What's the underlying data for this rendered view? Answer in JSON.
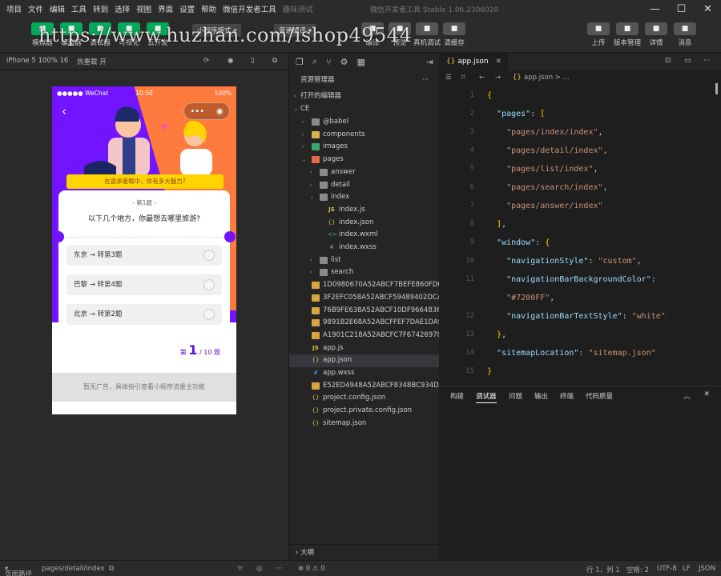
{
  "menubar": {
    "items": [
      "项目",
      "文件",
      "编辑",
      "工具",
      "转到",
      "选择",
      "视图",
      "界面",
      "设置",
      "帮助",
      "微信开发者工具"
    ],
    "extra": "趣味测试",
    "title": "微信开发者工具 Stable 1.06.2306020"
  },
  "toolbar": {
    "left": [
      {
        "icon": "simulator-icon",
        "label": "模拟器"
      },
      {
        "icon": "editor-icon",
        "label": "编辑器"
      },
      {
        "icon": "debugger-icon",
        "label": "调试器"
      },
      {
        "icon": "visualize-icon",
        "label": "可视化"
      },
      {
        "icon": "cloud-icon",
        "label": "云开发"
      }
    ],
    "mode_select": "小程序模式",
    "compile_select": "普通编译",
    "right_mid": [
      {
        "icon": "compile-icon",
        "label": "编译"
      },
      {
        "icon": "preview-icon",
        "label": "预览"
      },
      {
        "icon": "remote-debug-icon",
        "label": "真机调试"
      },
      {
        "icon": "clear-cache-icon",
        "label": "清缓存"
      }
    ],
    "right": [
      {
        "icon": "upload-icon",
        "label": "上传"
      },
      {
        "icon": "version-icon",
        "label": "版本管理"
      },
      {
        "icon": "details-icon",
        "label": "详情"
      },
      {
        "icon": "message-icon",
        "label": "消息"
      }
    ]
  },
  "watermark": "https://www.huzhan.com/ishop49544",
  "simulator": {
    "device": "iPhone 5 100% 16",
    "hot_reload": "热重载 开",
    "status": {
      "carrier": "●●●●● WeChat",
      "time": "10:50",
      "battery": "100%"
    },
    "banner": "在逃求者眼中，你有多大魅力?",
    "question_index": "- 第1题 -",
    "question": "以下几个地方，你最想去哪里旅游?",
    "options": [
      "东京 → 转第3题",
      "巴黎 → 转第4题",
      "北京 → 转第2题"
    ],
    "progress_prefix": "第",
    "progress_current": "1",
    "progress_suffix": "/ 10 题",
    "ad_text": "暂无广告，具体指引查看小程序流量主功能"
  },
  "explorer": {
    "header": "资源管理器",
    "open_editors": "打开的编辑器",
    "root": "CE",
    "outline": "大纲",
    "tree": [
      {
        "name": "@babel",
        "type": "folder",
        "depth": 1
      },
      {
        "name": "components",
        "type": "folder",
        "depth": 1
      },
      {
        "name": "images",
        "type": "folder",
        "depth": 1
      },
      {
        "name": "pages",
        "type": "folder",
        "depth": 1,
        "open": true
      },
      {
        "name": "answer",
        "type": "folder",
        "depth": 2
      },
      {
        "name": "detail",
        "type": "folder",
        "depth": 2
      },
      {
        "name": "index",
        "type": "folder",
        "depth": 2,
        "open": true
      },
      {
        "name": "index.js",
        "type": "js",
        "depth": 3
      },
      {
        "name": "index.json",
        "type": "json",
        "depth": 3
      },
      {
        "name": "index.wxml",
        "type": "wxml",
        "depth": 3
      },
      {
        "name": "index.wxss",
        "type": "wxss",
        "depth": 3
      },
      {
        "name": "list",
        "type": "folder",
        "depth": 2
      },
      {
        "name": "search",
        "type": "folder",
        "depth": 2
      },
      {
        "name": "1D0980670A52ABCF7BEFE860FD6...",
        "type": "png",
        "depth": 1
      },
      {
        "name": "3F2EFC058A52ABCF59489402DCA...",
        "type": "png",
        "depth": 1
      },
      {
        "name": "76B9FE638A52ABCF10DF9664836...",
        "type": "png",
        "depth": 1
      },
      {
        "name": "9891B2E68A52ABCFFEF7DAE1DA9...",
        "type": "png",
        "depth": 1
      },
      {
        "name": "A1901C218A52ABCFC7F67426978...",
        "type": "png",
        "depth": 1
      },
      {
        "name": "app.js",
        "type": "js",
        "depth": 1
      },
      {
        "name": "app.json",
        "type": "json",
        "depth": 1,
        "selected": true
      },
      {
        "name": "app.wxss",
        "type": "wxss",
        "depth": 1
      },
      {
        "name": "E52ED4948A52ABCF8348BC934D...",
        "type": "png",
        "depth": 1
      },
      {
        "name": "project.config.json",
        "type": "json",
        "depth": 1
      },
      {
        "name": "project.private.config.json",
        "type": "json",
        "depth": 1
      },
      {
        "name": "sitemap.json",
        "type": "json",
        "depth": 1
      }
    ]
  },
  "editor": {
    "tab": "app.json",
    "breadcrumb": "app.json > ...",
    "lines": [
      {
        "n": "1",
        "t": "{"
      },
      {
        "n": "2",
        "t": "  \"pages\": ["
      },
      {
        "n": "3",
        "t": "    \"pages/index/index\","
      },
      {
        "n": "4",
        "t": "    \"pages/detail/index\","
      },
      {
        "n": "5",
        "t": "    \"pages/list/index\","
      },
      {
        "n": "6",
        "t": "    \"pages/search/index\","
      },
      {
        "n": "7",
        "t": "    \"pages/answer/index\""
      },
      {
        "n": "8",
        "t": "  ],"
      },
      {
        "n": "9",
        "t": "  \"window\": {"
      },
      {
        "n": "10",
        "t": "    \"navigationStyle\": \"custom\","
      },
      {
        "n": "11",
        "t": "    \"navigationBarBackgroundColor\":"
      },
      {
        "n": "",
        "t": "    \"#7200FF\","
      },
      {
        "n": "12",
        "t": "    \"navigationBarTextStyle\": \"white\""
      },
      {
        "n": "13",
        "t": "  },"
      },
      {
        "n": "14",
        "t": "  \"sitemapLocation\": \"sitemap.json\""
      },
      {
        "n": "15",
        "t": "}"
      }
    ]
  },
  "panel": {
    "tabs": [
      "构建",
      "调试器",
      "问题",
      "输出",
      "终端",
      "代码质量"
    ],
    "active": "调试器"
  },
  "statusbar": {
    "page_path_label": "页面路径",
    "page_path": "pages/detail/index",
    "errors": "⊗ 0 ⚠ 0",
    "position": "行 1，列 1",
    "spaces": "空格: 2",
    "encoding": "UTF-8",
    "eol": "LF",
    "lang": "JSON"
  },
  "colors": {
    "nav": "#7200FF",
    "accent": "#07a85b",
    "orange": "#ff7a3d"
  }
}
